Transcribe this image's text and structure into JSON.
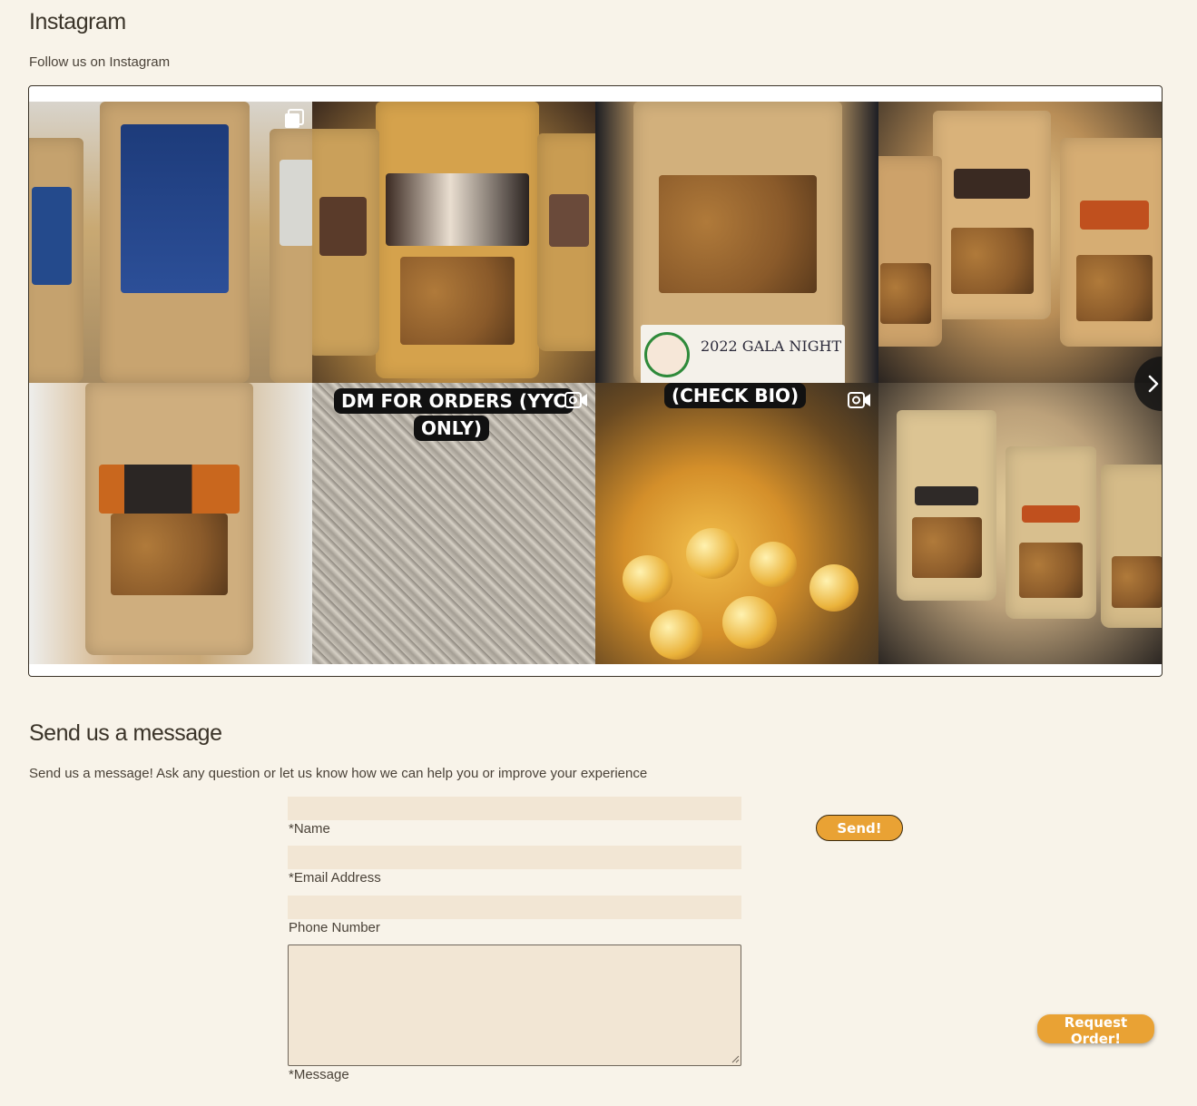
{
  "instagram": {
    "title": "Instagram",
    "subtitle": "Follow us on Instagram",
    "captions": {
      "tile_5": [
        "DM FOR ORDERS (YYC",
        "ONLY)"
      ],
      "tile_6": "(CHECK BIO)",
      "tile_2_sign": "2022 GALA NIGHT"
    },
    "icons": {
      "tile_0": "multiple-images-icon",
      "tile_5": "video-camera-icon",
      "tile_6": "video-camera-icon",
      "next": "chevron-right-icon"
    }
  },
  "message": {
    "title": "Send us a message",
    "subtitle": "Send us a message! Ask any question or let us know how we can help you or improve your experience",
    "fields": {
      "name_label": "*Name",
      "email_label": "*Email Address",
      "phone_label": "Phone Number",
      "message_label": "*Message"
    },
    "send_label": "Send!"
  },
  "floating": {
    "request_label": "Request Order!"
  },
  "colors": {
    "background": "#f8f3e9",
    "accent": "#e9a234",
    "input_fill": "#f2e6d4",
    "text": "#3a3328"
  }
}
